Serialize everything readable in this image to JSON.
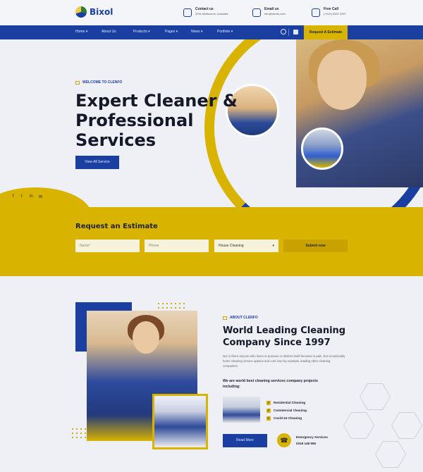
{
  "brand": {
    "name": "Bixol"
  },
  "contacts": [
    {
      "label": "Contact us",
      "value": "2231 Melbourne, Australia"
    },
    {
      "label": "Email us",
      "value": "info@clenfo.com"
    },
    {
      "label": "Free Call",
      "value": "(+012) 6492 2297"
    }
  ],
  "nav": {
    "items": [
      "Home",
      "About Us",
      "Products",
      "Pages",
      "News",
      "Portfolio"
    ],
    "cta": "Request A Estimate"
  },
  "hero": {
    "eyebrow": "WELCOME TO CLENFO",
    "title": "Expert Cleaner & Professional Services",
    "button": "View All Service",
    "social": [
      "f",
      "t",
      "in",
      "✉"
    ]
  },
  "estimate": {
    "title": "Request an Estimate",
    "name_placeholder": "Name*",
    "phone_placeholder": "Phone",
    "service_selected": "House Cleaning",
    "submit": "Submit now"
  },
  "about": {
    "eyebrow": "ABOUT CLENFO",
    "title": "World Leading Cleaning Company Since 1997",
    "description": "Nor is there anyone who loves or pursues or desires itself because is pain, but occasionally home cleaning service options and cont inue by example, leading other cleaning companies.",
    "subheading": "We are world best cleaning services company projects including:",
    "list": [
      "Residential Cleaning",
      "Commercial Cleaning",
      "Covid-19 Cleaning"
    ],
    "button": "Read More",
    "emergency_label": "Emergency Services",
    "emergency_number": "0318 148 965"
  },
  "colors": {
    "primary": "#1b3fa0",
    "accent": "#d8b400"
  }
}
